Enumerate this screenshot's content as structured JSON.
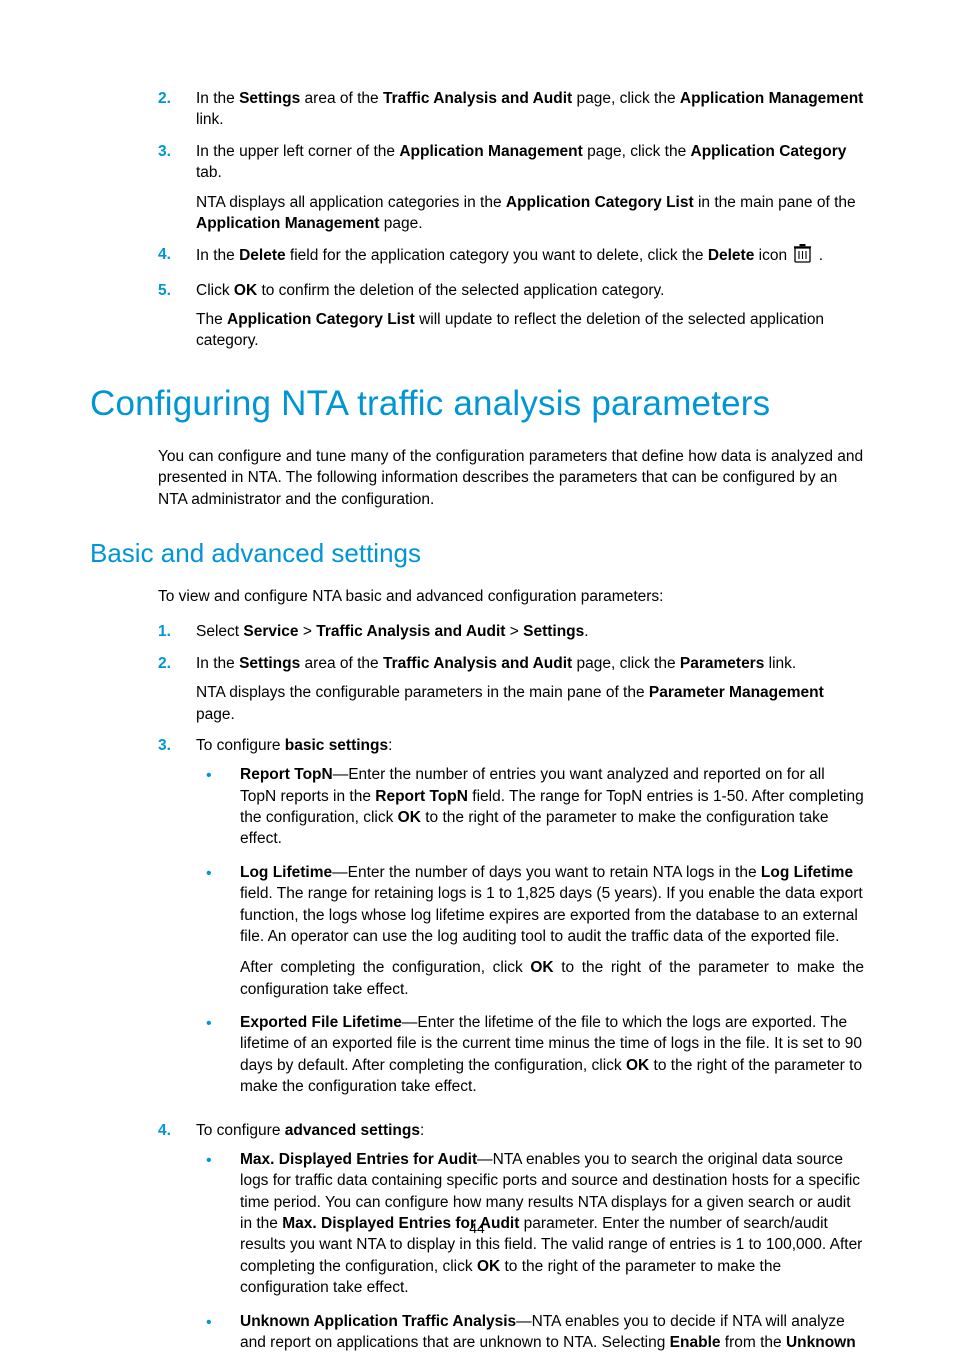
{
  "top_list": {
    "items": [
      {
        "num": "2.",
        "html": "In the <strong>Settings</strong> area of the <strong>Traffic Analysis and Audit</strong> page, click the <strong>Application Management</strong> link."
      },
      {
        "num": "3.",
        "html": "In the upper left corner of the <strong>Application Management</strong> page, click the <strong>Application Category</strong> tab.",
        "extra_html": "NTA displays all application categories in the <strong>Application Category List</strong> in the main pane of the <strong>Application Management</strong> page."
      },
      {
        "num": "4.",
        "pre_icon_html": "In the <strong>Delete</strong> field for the application category you want to delete, click the <strong>Delete</strong> icon",
        "post_icon_html": "."
      },
      {
        "num": "5.",
        "html": "Click <strong>OK</strong> to confirm the deletion of the selected application category.",
        "extra_html": "The <strong>Application Category List</strong> will update to reflect the deletion of the selected application category."
      }
    ]
  },
  "h1": "Configuring NTA traffic analysis parameters",
  "intro": "You can configure and tune many of the configuration parameters that define how data is analyzed and presented in NTA. The following information describes the parameters that can be configured by an NTA administrator and the configuration.",
  "h2": "Basic and advanced settings",
  "lead": "To view and configure NTA basic and advanced configuration parameters:",
  "steps": {
    "items": [
      {
        "num": "1.",
        "html": "Select <strong>Service</strong> &gt; <strong>Traffic Analysis and Audit</strong> &gt; <strong>Settings</strong>."
      },
      {
        "num": "2.",
        "html": "In the <strong>Settings</strong> area of the <strong>Traffic Analysis and Audit</strong> page, click the <strong>Parameters</strong> link.",
        "extra_html": "NTA displays the configurable parameters in the main pane of the <strong>Parameter Management</strong> page."
      },
      {
        "num": "3.",
        "html": "To configure <strong>basic settings</strong>:",
        "bullets": [
          {
            "html": "<strong>Report TopN</strong>—Enter the number of entries you want analyzed and reported on for all TopN reports in the <strong>Report TopN</strong> field. The range for TopN entries is 1-50. After completing the configuration, click <strong>OK</strong> to the right of the parameter to make the configuration take effect."
          },
          {
            "html": "<strong>Log Lifetime</strong>—Enter the number of days you want to retain NTA logs in the <strong>Log Lifetime</strong> field. The range for retaining logs is 1 to 1,825 days (5 years). If you enable the data export function, the logs whose log lifetime expires are exported from the database to an external file. An operator can use the log auditing tool to audit the traffic data of the exported file.",
            "extra_html": "After completing the configuration, click <strong>OK</strong> to the right of the parameter to make the configuration take effect.",
            "extra_justify": true
          },
          {
            "html": "<strong>Exported File Lifetime</strong>—Enter the lifetime of the file to which the logs are exported. The lifetime of an exported file is the current time minus the time of logs in the file. It is set to 90 days by default. After completing the configuration, click <strong>OK</strong> to the right of the parameter to make the configuration take effect."
          }
        ]
      },
      {
        "num": "4.",
        "html": "To configure <strong>advanced settings</strong>:",
        "bullets": [
          {
            "html": "<strong>Max. Displayed Entries for Audit</strong>—NTA enables you to search the original data source logs for traffic data containing specific ports and source and destination hosts for a specific time period. You can configure how many results NTA displays for a given search or audit in the <strong>Max. Displayed Entries for Audit</strong> parameter. Enter the number of search/audit results you want NTA to display in this field. The valid range of entries is 1 to 100,000. After completing the configuration, click <strong>OK</strong> to the right of the parameter to make the configuration take effect."
          },
          {
            "html": "<strong>Unknown Application Traffic Analysis</strong>—NTA enables you to decide if NTA will analyze and report on applications that are unknown to NTA. Selecting <strong>Enable</strong> from the <strong>Unknown</strong>"
          }
        ]
      }
    ]
  },
  "page_number": "44"
}
